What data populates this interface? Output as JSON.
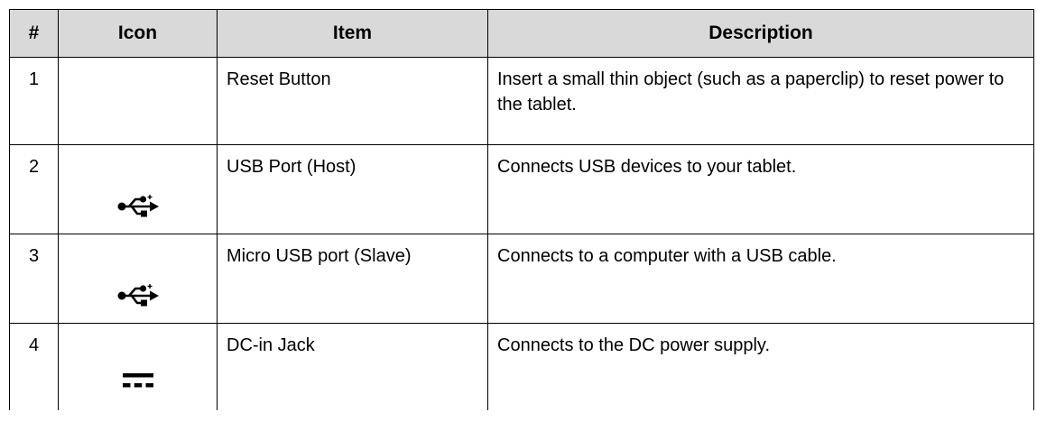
{
  "table": {
    "headers": [
      "#",
      "Icon",
      "Item",
      "Description"
    ],
    "rows": [
      {
        "num": "1",
        "icon": "",
        "item": "Reset Button",
        "description": "Insert a small thin object (such as a paperclip) to reset power to the tablet."
      },
      {
        "num": "2",
        "icon": "usb-icon",
        "item": "USB Port (Host)",
        "description": "Connects USB devices to your tablet."
      },
      {
        "num": "3",
        "icon": "usb-icon",
        "item": "Micro USB port (Slave)",
        "description": "Connects to a computer with a USB cable."
      },
      {
        "num": "4",
        "icon": "dc-power-icon",
        "item": "DC-in Jack",
        "description": "Connects to the DC power supply."
      }
    ]
  }
}
